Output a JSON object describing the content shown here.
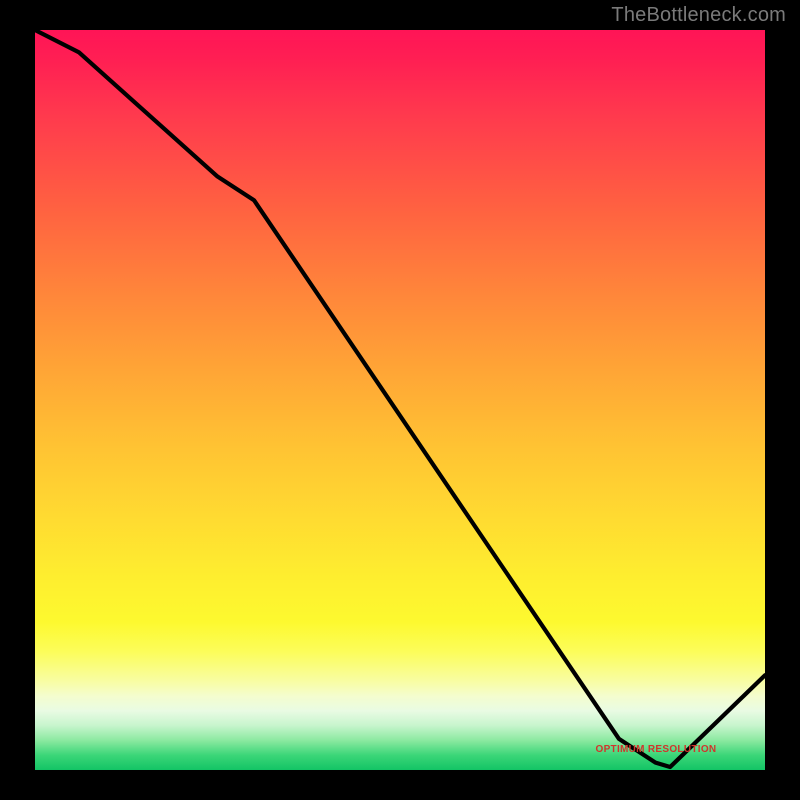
{
  "watermark": "TheBottleneck.com",
  "optimum_label": "OPTIMUM RESOLUTION",
  "chart_data": {
    "type": "line",
    "title": "",
    "xlabel": "",
    "ylabel": "",
    "xlim": [
      0,
      100
    ],
    "ylim": [
      0,
      100
    ],
    "x": [
      0,
      6,
      25,
      30,
      80,
      85,
      87,
      100
    ],
    "values": [
      100,
      97,
      80.2,
      77,
      4.2,
      1.0,
      0.4,
      12.8
    ],
    "optimum_x": 85,
    "gradient_note": "vertical red→yellow→green background, green band at bottom"
  },
  "colors": {
    "curve": "#000000",
    "background_frame": "#000000",
    "optimum_label": "#d0352c"
  }
}
